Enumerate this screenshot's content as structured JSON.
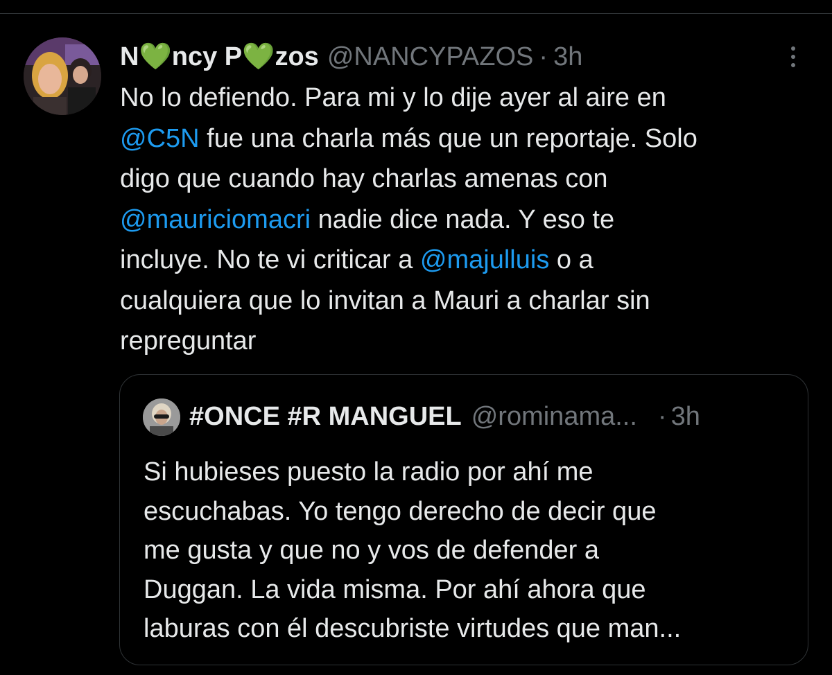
{
  "tweet": {
    "display_name": "N💚ncy P💚zos",
    "handle": "@NANCYPAZOS",
    "separator": "·",
    "time": "3h",
    "body_lines": [
      [
        {
          "t": "No lo defiendo. Para mi y lo dije ayer al aire en"
        }
      ],
      [
        {
          "t": "@C5N",
          "m": true
        },
        {
          "t": " fue una charla más que un reportaje. Solo"
        }
      ],
      [
        {
          "t": "digo que cuando hay charlas amenas con"
        }
      ],
      [
        {
          "t": "@mauriciomacri",
          "m": true
        },
        {
          "t": " nadie dice nada. Y eso te"
        }
      ],
      [
        {
          "t": "incluye. No te vi criticar a "
        },
        {
          "t": "@majulluis",
          "m": true
        },
        {
          "t": " o a"
        }
      ],
      [
        {
          "t": "cualquiera que lo invitan a Mauri a charlar sin"
        }
      ],
      [
        {
          "t": "repreguntar"
        }
      ]
    ]
  },
  "quoted": {
    "display_name": "#ONCE #R MANGUEL",
    "handle": "@rominama...",
    "separator": "·",
    "time": "3h",
    "body_lines": [
      "Si hubieses puesto la radio por ahí me",
      "escuchabas. Yo tengo derecho de decir que",
      "me gusta y que no y vos de defender a",
      "Duggan. La vida misma. Por ahí ahora que",
      "laburas con él descubriste virtudes que man..."
    ]
  },
  "colors": {
    "background": "#000000",
    "text": "#e7e9ea",
    "secondary": "#71767b",
    "mention": "#1d9bf0",
    "border": "#2f3336"
  },
  "icons": {
    "more": "more-vertical-icon"
  }
}
